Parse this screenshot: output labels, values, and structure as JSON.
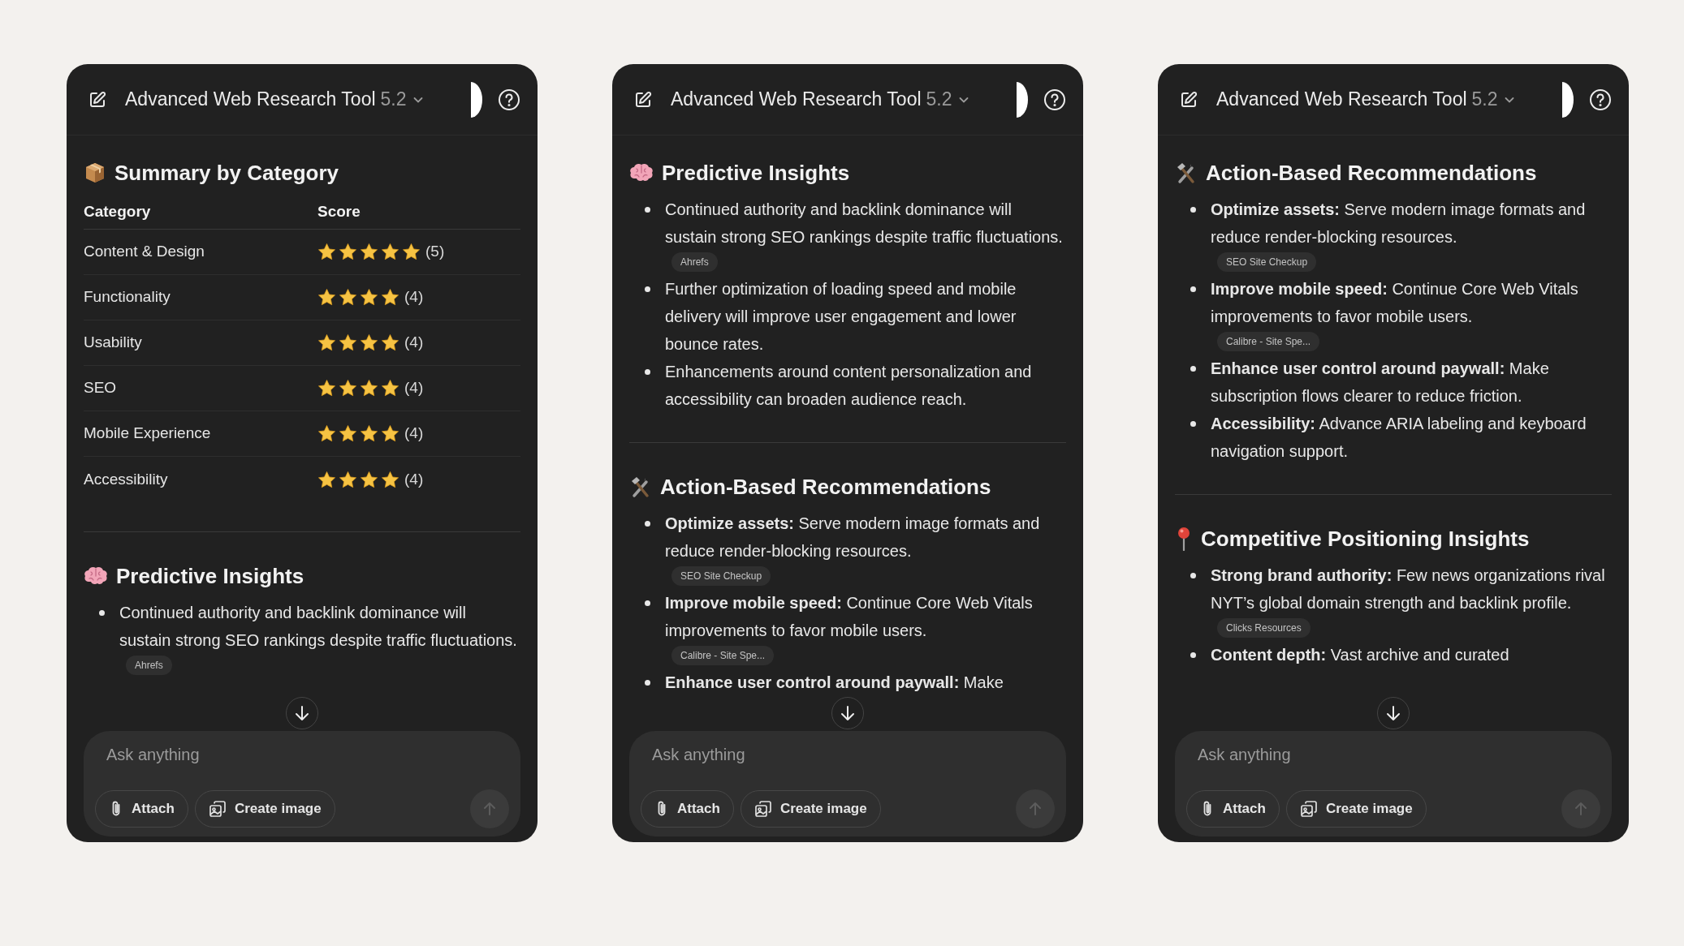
{
  "panels": [
    {
      "header": {
        "title": "Advanced Web Research Tool",
        "version": "5.2"
      },
      "sections": [
        {
          "kind": "summary",
          "title": "Summary by Category",
          "columns": [
            "Category",
            "Score"
          ],
          "rows": [
            {
              "category": "Content & Design",
              "stars": 5,
              "score": "(5)"
            },
            {
              "category": "Functionality",
              "stars": 4,
              "score": "(4)"
            },
            {
              "category": "Usability",
              "stars": 4,
              "score": "(4)"
            },
            {
              "category": "SEO",
              "stars": 4,
              "score": "(4)"
            },
            {
              "category": "Mobile Experience",
              "stars": 4,
              "score": "(4)"
            },
            {
              "category": "Accessibility",
              "stars": 4,
              "score": "(4)"
            }
          ]
        },
        {
          "kind": "predictive",
          "title": "Predictive Insights",
          "bullets": [
            {
              "text": "Continued authority and backlink dominance will sustain strong SEO rankings despite traffic fluctuations.",
              "source": "Ahrefs"
            }
          ]
        }
      ],
      "composer": {
        "placeholder": "Ask anything",
        "buttons": [
          {
            "kind": "attach",
            "label": "Attach"
          },
          {
            "kind": "create_image",
            "label": "Create image"
          }
        ]
      }
    },
    {
      "header": {
        "title": "Advanced Web Research Tool",
        "version": "5.2"
      },
      "sections": [
        {
          "kind": "predictive",
          "title": "Predictive Insights",
          "bullets": [
            {
              "text": "Continued authority and backlink dominance will sustain strong SEO rankings despite traffic fluctuations.",
              "source": "Ahrefs"
            },
            {
              "text": "Further optimization of loading speed and mobile delivery will improve user engagement and lower bounce rates."
            },
            {
              "text": "Enhancements around content personalization and accessibility can broaden audience reach."
            }
          ]
        },
        {
          "kind": "actions",
          "title": "Action-Based Recommendations",
          "bullets": [
            {
              "text": "**Optimize assets:** Serve modern image formats and reduce render-blocking resources.",
              "source": "SEO Site Checkup"
            },
            {
              "text": "**Improve mobile speed:** Continue Core Web Vitals improvements to favor mobile users.",
              "source": "Calibre - Site Spe..."
            },
            {
              "text": "**Enhance user control around paywall:** Make"
            }
          ]
        }
      ],
      "composer": {
        "placeholder": "Ask anything",
        "buttons": [
          {
            "kind": "attach",
            "label": "Attach"
          },
          {
            "kind": "create_image",
            "label": "Create image"
          }
        ]
      }
    },
    {
      "header": {
        "title": "Advanced Web Research Tool",
        "version": "5.2"
      },
      "sections": [
        {
          "kind": "actions",
          "title": "Action-Based Recommendations",
          "bullets": [
            {
              "text": "**Optimize assets:** Serve modern image formats and reduce render-blocking resources.",
              "source": "SEO Site Checkup"
            },
            {
              "text": "**Improve mobile speed:** Continue Core Web Vitals improvements to favor mobile users.",
              "source": "Calibre - Site Spe..."
            },
            {
              "text": "**Enhance user control around paywall:** Make subscription flows clearer to reduce friction."
            },
            {
              "text": "**Accessibility:** Advance ARIA labeling and keyboard navigation support."
            }
          ]
        },
        {
          "kind": "competitive",
          "title": "Competitive Positioning Insights",
          "bullets": [
            {
              "text": "**Strong brand authority:** Few news organizations rival NYT’s global domain strength and backlink profile.",
              "source": "Clicks Resources"
            },
            {
              "text": "**Content depth:** Vast archive and curated"
            }
          ]
        }
      ],
      "composer": {
        "placeholder": "Ask anything",
        "buttons": [
          {
            "kind": "attach",
            "label": "Attach"
          },
          {
            "kind": "create_image",
            "label": "Create image"
          }
        ]
      }
    }
  ]
}
